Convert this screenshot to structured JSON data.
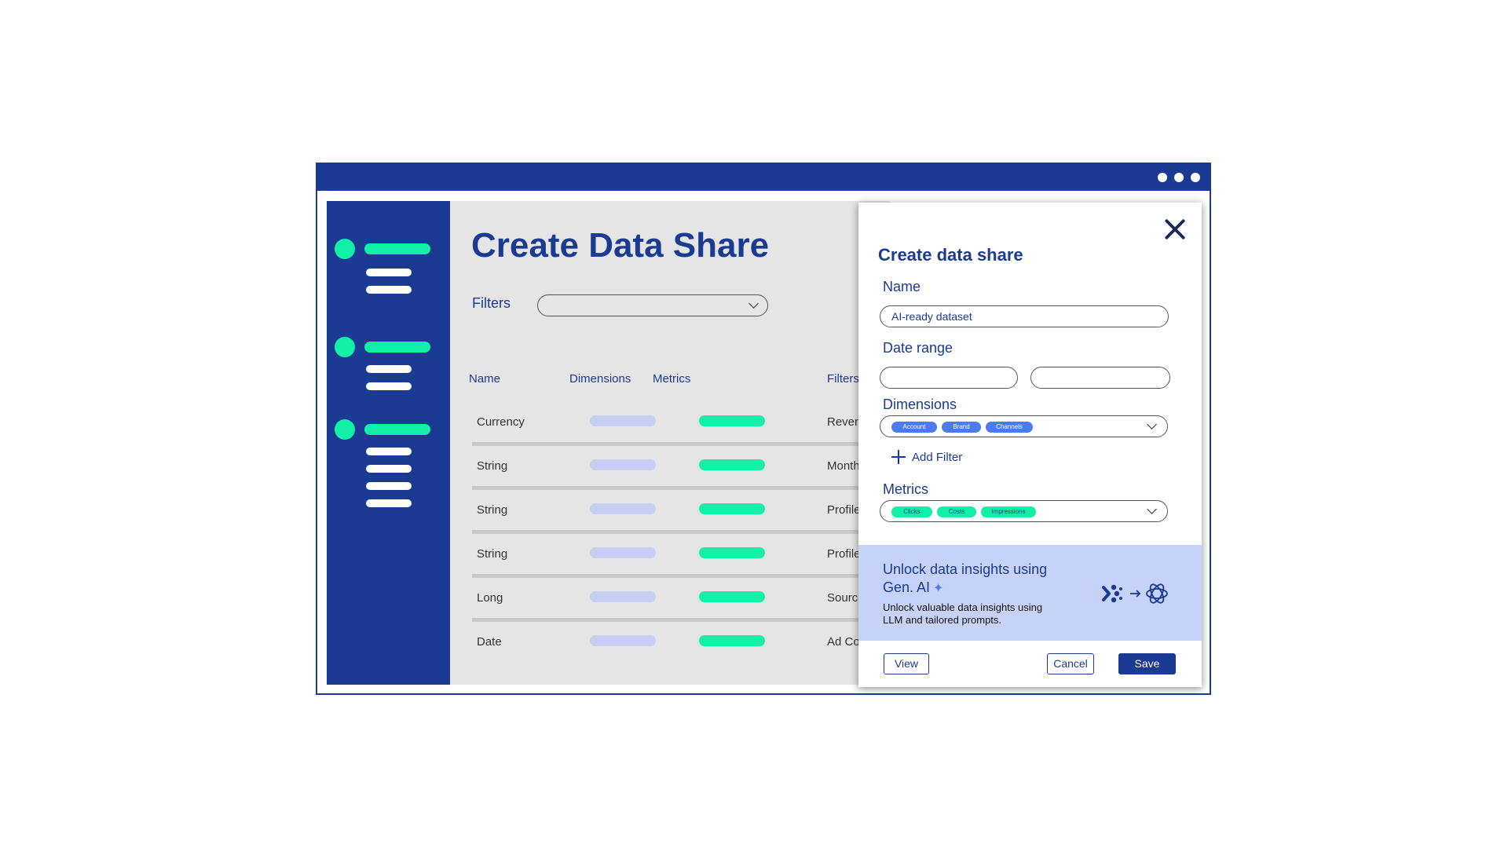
{
  "main": {
    "title": "Create Data Share",
    "filters_label": "Filters",
    "columns": [
      "Name",
      "Dimensions",
      "Metrics",
      "Filters"
    ],
    "rows": [
      {
        "name": "Currency",
        "filter": "Reven"
      },
      {
        "name": "String",
        "filter": "Month"
      },
      {
        "name": "String",
        "filter": "Profile"
      },
      {
        "name": "String",
        "filter": "Profile"
      },
      {
        "name": "Long",
        "filter": "Source"
      },
      {
        "name": "Date",
        "filter": "Ad Co"
      }
    ]
  },
  "panel": {
    "title": "Create data share",
    "name_label": "Name",
    "name_value": "AI-ready dataset",
    "date_range_label": "Date range",
    "dimensions_label": "Dimensions",
    "dimension_tags": [
      "Account",
      "Brand",
      "Channels"
    ],
    "add_filter_label": "Add Filter",
    "metrics_label": "Metrics",
    "metric_tags": [
      "Clicks",
      "Costs",
      "Impressions"
    ],
    "ai_title": "Unlock data insights using Gen. AI",
    "ai_desc": "Unlock valuable data insights using LLM and tailored prompts.",
    "view_label": "View",
    "cancel_label": "Cancel",
    "save_label": "Save"
  },
  "colors": {
    "brand_blue": "#1b3b93",
    "accent_green": "#12f0a8",
    "light_blue": "#c6d0f7",
    "tag_blue": "#4a7bf0"
  },
  "icons": [
    "close-icon",
    "chevron-down-icon",
    "plus-icon",
    "sparkle-icon",
    "brand-logo-icon",
    "arrow-right-icon",
    "openai-logo-icon"
  ]
}
